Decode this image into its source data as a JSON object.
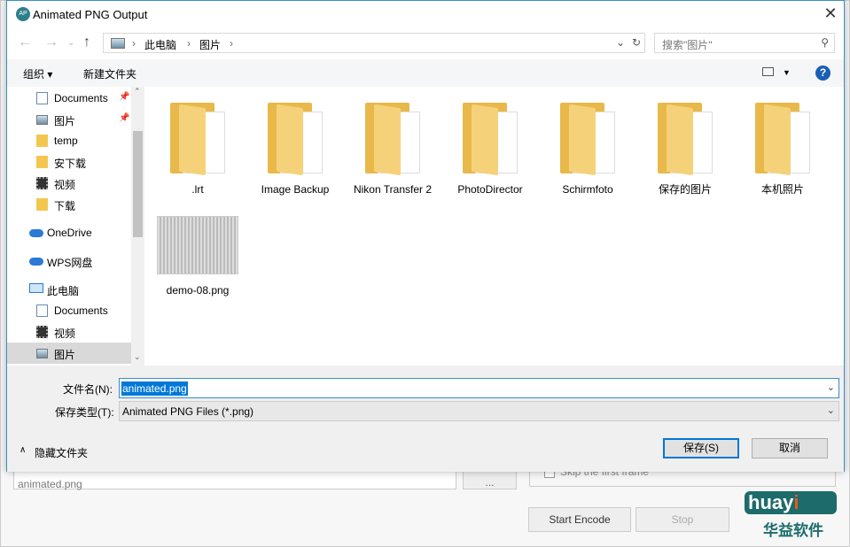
{
  "background_app": {
    "output_value": "animated.png",
    "browse_label": "...",
    "skip_label": "Skip the first frame",
    "start_label": "Start Encode",
    "stop_label": "Stop"
  },
  "dialog": {
    "title": "Animated PNG Output",
    "address": {
      "crumbs": [
        "此电脑",
        "图片"
      ]
    },
    "search_placeholder": "搜索\"图片\"",
    "toolbar": {
      "organize": "组织 ▾",
      "new_folder": "新建文件夹",
      "help": "?"
    },
    "sidebar": [
      {
        "label": "Documents",
        "icon": "document-icon",
        "pinned": true
      },
      {
        "label": "图片",
        "icon": "pictures-icon",
        "pinned": true
      },
      {
        "label": "temp",
        "icon": "folder-icon"
      },
      {
        "label": "安下载",
        "icon": "folder-icon"
      },
      {
        "label": "视频",
        "icon": "video-icon"
      },
      {
        "label": "下载",
        "icon": "folder-icon"
      },
      {
        "label": "OneDrive",
        "icon": "cloud-icon"
      },
      {
        "label": "WPS网盘",
        "icon": "cloud-icon"
      },
      {
        "label": "此电脑",
        "icon": "computer-icon"
      },
      {
        "label": "Documents",
        "icon": "document-icon"
      },
      {
        "label": "视频",
        "icon": "video-icon"
      },
      {
        "label": "图片",
        "icon": "pictures-icon",
        "selected": true
      }
    ],
    "files": [
      {
        "name": ".lrt",
        "type": "folder"
      },
      {
        "name": "Image Backup",
        "type": "folder"
      },
      {
        "name": "Nikon Transfer 2",
        "type": "folder"
      },
      {
        "name": "PhotoDirector",
        "type": "folder"
      },
      {
        "name": "Schirmfoto",
        "type": "folder"
      },
      {
        "name": "保存的图片",
        "type": "folder"
      },
      {
        "name": "本机照片",
        "type": "folder"
      },
      {
        "name": "demo-08.png",
        "type": "image"
      }
    ],
    "filename_label": "文件名(N):",
    "filename_value": "animated.png",
    "filetype_label": "保存类型(T):",
    "filetype_value": "Animated PNG Files (*.png)",
    "hide_folders": "隐藏文件夹",
    "save_label": "保存(S)",
    "cancel_label": "取消"
  },
  "watermark": {
    "text": "huayi",
    "sub": "华益软件"
  }
}
